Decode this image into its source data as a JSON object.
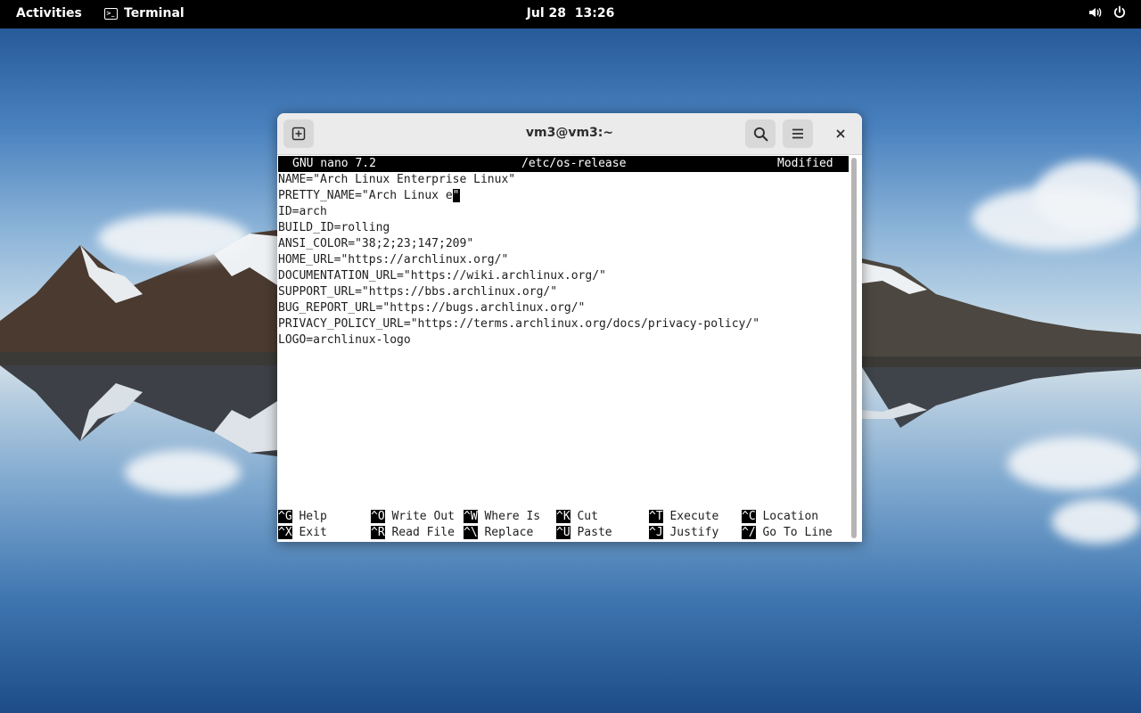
{
  "topbar": {
    "activities": "Activities",
    "app_name": "Terminal",
    "date": "Jul 28",
    "time": "13:26",
    "icons": [
      "speaker-icon",
      "power-icon"
    ]
  },
  "window": {
    "title": "vm3@vm3:~",
    "buttons": [
      "new-tab-icon",
      "search-icon",
      "hamburger-menu-icon",
      "close-icon"
    ]
  },
  "nano": {
    "version": "GNU nano 7.2",
    "filename": "/etc/os-release",
    "status": "Modified",
    "lines": [
      "NAME=\"Arch Linux Enterprise Linux\"",
      "PRETTY_NAME=\"Arch Linux e",
      "ID=arch",
      "BUILD_ID=rolling",
      "ANSI_COLOR=\"38;2;23;147;209\"",
      "HOME_URL=\"https://archlinux.org/\"",
      "DOCUMENTATION_URL=\"https://wiki.archlinux.org/\"",
      "SUPPORT_URL=\"https://bbs.archlinux.org/\"",
      "BUG_REPORT_URL=\"https://bugs.archlinux.org/\"",
      "PRIVACY_POLICY_URL=\"https://terms.archlinux.org/docs/privacy-policy/\"",
      "LOGO=archlinux-logo"
    ],
    "cursor_char": "\"",
    "shortcuts_row1": [
      {
        "key": "^G",
        "label": "Help"
      },
      {
        "key": "^O",
        "label": "Write Out"
      },
      {
        "key": "^W",
        "label": "Where Is"
      },
      {
        "key": "^K",
        "label": "Cut"
      },
      {
        "key": "^T",
        "label": "Execute"
      },
      {
        "key": "^C",
        "label": "Location"
      }
    ],
    "shortcuts_row2": [
      {
        "key": "^X",
        "label": "Exit"
      },
      {
        "key": "^R",
        "label": "Read File"
      },
      {
        "key": "^\\",
        "label": "Replace"
      },
      {
        "key": "^U",
        "label": "Paste"
      },
      {
        "key": "^J",
        "label": "Justify"
      },
      {
        "key": "^/",
        "label": "Go To Line"
      }
    ]
  }
}
